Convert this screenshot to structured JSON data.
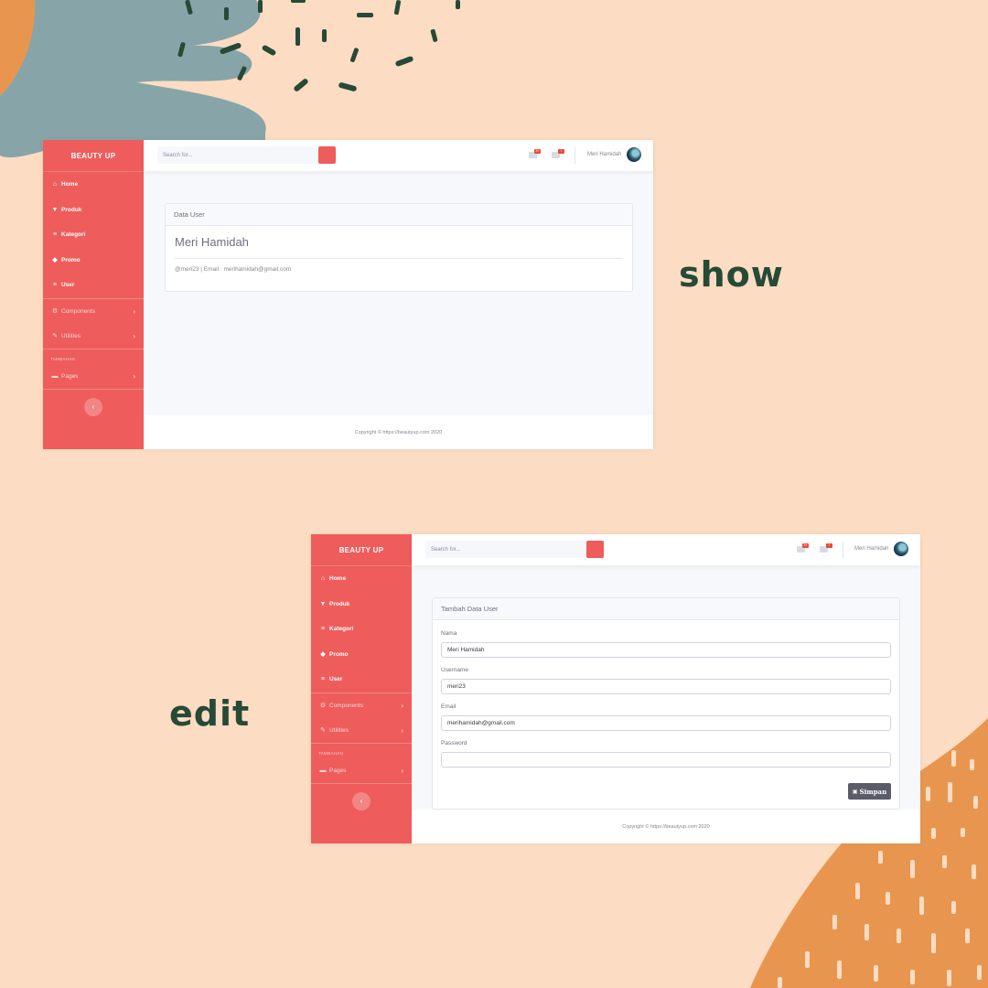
{
  "captions": {
    "show": "show",
    "edit": "edit"
  },
  "colors": {
    "background": "#fcdcc2",
    "sidebar": "#ee5c5c",
    "caption": "#264a36",
    "blob_orange": "#e8964f",
    "blob_teal": "#87a5a8"
  },
  "app": {
    "brand": "BEAUTY UP",
    "nav": [
      {
        "label": "Home",
        "icon": "home-icon"
      },
      {
        "label": "Produk",
        "icon": "cart-icon"
      },
      {
        "label": "Kategori",
        "icon": "list-icon"
      },
      {
        "label": "Promo",
        "icon": "tag-icon"
      },
      {
        "label": "User",
        "icon": "list-icon"
      }
    ],
    "sub_nav": [
      {
        "label": "Components",
        "icon": "gear-icon"
      },
      {
        "label": "Utilities",
        "icon": "wrench-icon"
      }
    ],
    "section_heading": "TAMBAHAN",
    "pages_item": {
      "label": "Pages",
      "icon": "folder-icon"
    },
    "search_placeholder": "Search for...",
    "alerts_badge": "3+",
    "messages_badge": "7",
    "user_name": "Meri Hamidah",
    "footer": "Copyright © https://beautyup.com 2020"
  },
  "show_view": {
    "card_title": "Data User",
    "user_fullname": "Meri Hamidah",
    "user_details": "@meri23 | Email : merihamidah@gmail.com"
  },
  "edit_view": {
    "card_title": "Tambah Data User",
    "fields": [
      {
        "label": "Nama",
        "value": "Meri Hamidah"
      },
      {
        "label": "Username",
        "value": "meri23"
      },
      {
        "label": "Email",
        "value": "merihamidah@gmail.com"
      },
      {
        "label": "Password",
        "value": ""
      }
    ],
    "save_label": "Simpan"
  }
}
